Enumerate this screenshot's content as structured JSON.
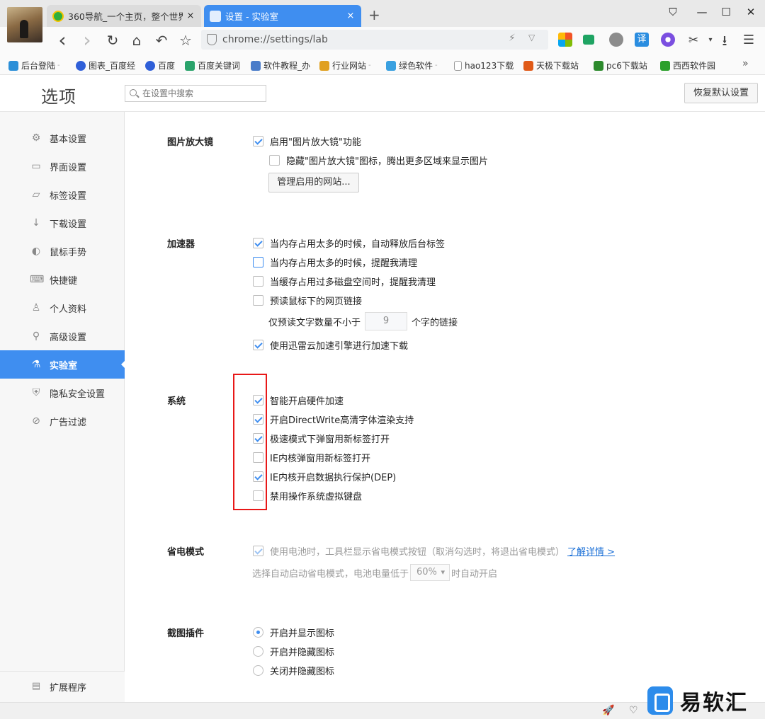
{
  "tabs": [
    {
      "title": "360导航_一个主页，整个世界",
      "close": "×"
    },
    {
      "title": "设置 - 实验室",
      "close": "×"
    }
  ],
  "new_tab": "+",
  "window_controls": {
    "pin": "⛉",
    "minimize": "—",
    "maximize": "☐",
    "close": "✕"
  },
  "toolbar": {
    "back": "‹",
    "forward": "›",
    "reload": "↻",
    "home": "⌂",
    "undo": "↶",
    "star": "☆",
    "url": "chrome://settings/lab",
    "cut_menu": "✂",
    "download": "⭳",
    "menu": "☰",
    "ext_translate": "译"
  },
  "bookmarks": [
    {
      "label": "后台登陆",
      "color": "#2b8fd8"
    },
    {
      "label": "图表_百度经",
      "color": "#2f5fd8"
    },
    {
      "label": "百度",
      "color": "#2f5fd8"
    },
    {
      "label": "百度关键词",
      "color": "#2aa36b"
    },
    {
      "label": "软件教程_办",
      "color": "#4a7cc9"
    },
    {
      "label": "行业网站",
      "color": "#e0a020"
    },
    {
      "label": "绿色软件",
      "color": "#3aa0e0"
    },
    {
      "label": "hao123下载",
      "color": "#cccccc"
    },
    {
      "label": "天极下载站",
      "color": "#e05a18"
    },
    {
      "label": "pc6下载站",
      "color": "#2d8a2d"
    },
    {
      "label": "西西软件园",
      "color": "#2ca02c"
    }
  ],
  "bookmarks_more": "»",
  "header": {
    "title": "选项",
    "search_placeholder": "在设置中搜索",
    "restore_label": "恢复默认设置"
  },
  "sidebar": {
    "items": [
      {
        "label": "基本设置",
        "icon": "⚙"
      },
      {
        "label": "界面设置",
        "icon": "▭"
      },
      {
        "label": "标签设置",
        "icon": "▱"
      },
      {
        "label": "下载设置",
        "icon": "↓"
      },
      {
        "label": "鼠标手势",
        "icon": "◐"
      },
      {
        "label": "快捷键",
        "icon": "⌨"
      },
      {
        "label": "个人资料",
        "icon": "♙"
      },
      {
        "label": "高级设置",
        "icon": "⚲"
      },
      {
        "label": "实验室",
        "icon": "⚗"
      },
      {
        "label": "隐私安全设置",
        "icon": "⛨"
      },
      {
        "label": "广告过滤",
        "icon": "⊘"
      }
    ],
    "footer": {
      "label": "扩展程序",
      "icon": "▤"
    }
  },
  "magnifier": {
    "label": "图片放大镜",
    "opt_enable": "启用\"图片放大镜\"功能",
    "opt_hide": "隐藏\"图片放大镜\"图标，腾出更多区域来显示图片",
    "manage_btn": "管理启用的网站..."
  },
  "accelerator": {
    "label": "加速器",
    "opt1": "当内存占用太多的时候，自动释放后台标签",
    "opt2": "当内存占用太多的时候，提醒我清理",
    "opt3": "当缓存占用过多磁盘空间时，提醒我清理",
    "opt4": "预读鼠标下的网页链接",
    "prefetch_prefix": "仅预读文字数量不小于",
    "prefetch_value": "9",
    "prefetch_suffix": "个字的链接",
    "opt5": "使用迅雷云加速引擎进行加速下载"
  },
  "system": {
    "label": "系统",
    "opt1": "智能开启硬件加速",
    "opt2": "开启DirectWrite高清字体渲染支持",
    "opt3": "极速模式下弹窗用新标签打开",
    "opt4": "IE内核弹窗用新标签打开",
    "opt5": "IE内核开启数据执行保护(DEP)",
    "opt6": "禁用操作系统虚拟键盘"
  },
  "power": {
    "label": "省电模式",
    "opt1": "使用电池时，工具栏显示省电模式按钮（取消勾选时，将退出省电模式）",
    "link": "了解详情 >",
    "auto_prefix": "选择自动启动省电模式，电池电量低于",
    "auto_value": "60%",
    "auto_suffix": "时自动开启"
  },
  "screenshot": {
    "label": "截图插件",
    "r1": "开启并显示图标",
    "r2": "开启并隐藏图标",
    "r3": "关闭并隐藏图标"
  },
  "status_icons": {
    "rocket": "🚀",
    "heart": "♡"
  },
  "watermark": "易软汇",
  "colors": {
    "accent": "#3f8ef0",
    "highlight_box": "#e81818"
  }
}
